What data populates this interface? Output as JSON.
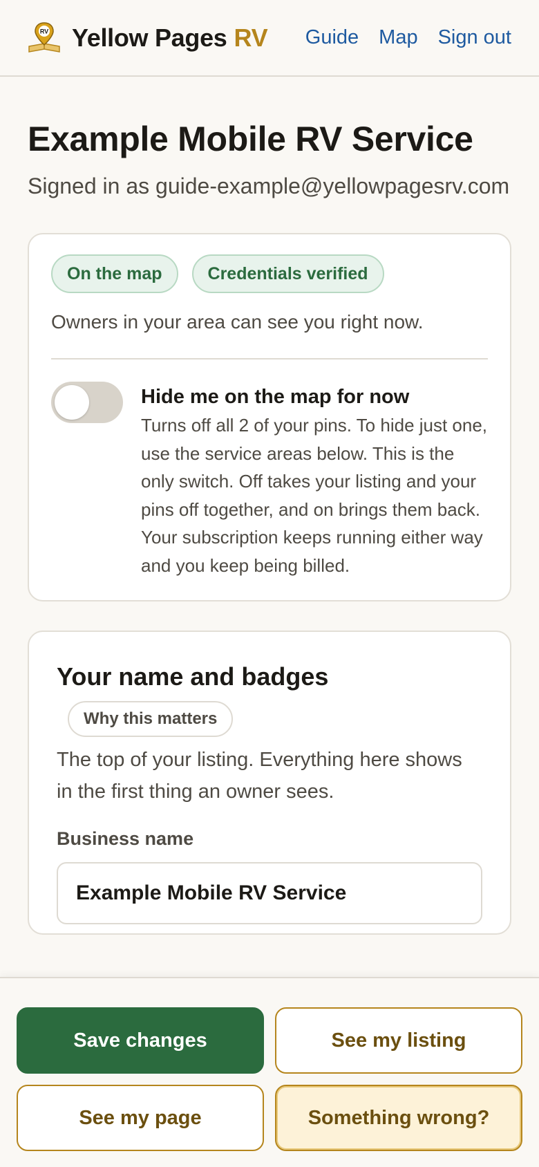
{
  "header": {
    "brand_name": "Yellow Pages",
    "brand_suffix": "RV",
    "logo_badge_text": "RV",
    "nav": [
      "Guide",
      "Map",
      "Sign out"
    ]
  },
  "page": {
    "title": "Example Mobile RV Service",
    "signed_in_text": "Signed in as guide-example@yellowpagesrv.com"
  },
  "status": {
    "badges": [
      "On the map",
      "Credentials verified"
    ],
    "text": "Owners in your area can see you right now.",
    "toggle_on": false,
    "toggle_title": "Hide me on the map for now",
    "toggle_desc": "Turns off all 2 of your pins. To hide just one, use the service areas below. This is the only switch. Off takes your listing and your pins off together, and on brings them back. Your subscription keeps running either way and you keep being billed."
  },
  "name_section": {
    "title": "Your name and badges",
    "why_label": "Why this matters",
    "desc": "The top of your listing. Everything here shows in the first thing an owner sees.",
    "business_name_label": "Business name",
    "business_name_value": "Example Mobile RV Service"
  },
  "actions": {
    "save": "Save changes",
    "see_listing": "See my listing",
    "see_page": "See my page",
    "something_wrong": "Something wrong?"
  },
  "colors": {
    "accent_gold": "#b5851c",
    "primary_green": "#2b6b3e",
    "link_blue": "#1e5aa0",
    "background": "#faf8f4"
  },
  "icons": {
    "logo": "map-pin-book-icon"
  }
}
